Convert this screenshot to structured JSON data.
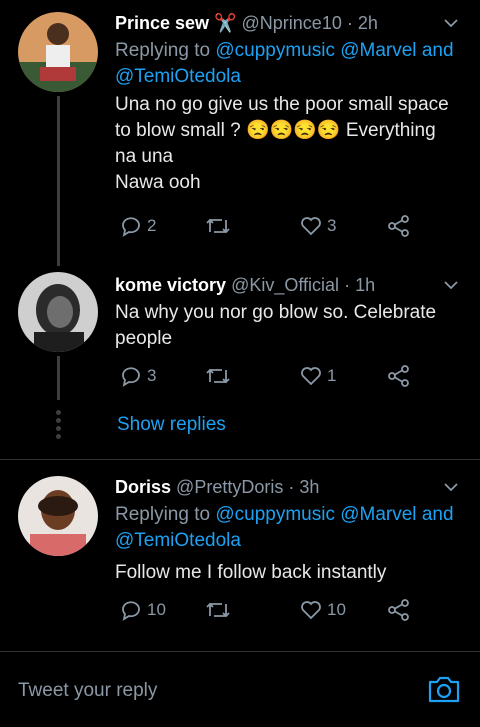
{
  "tweets": [
    {
      "name": "Prince sew",
      "emoji": "✂️",
      "handle": "@Nprince10",
      "time": "· 2h",
      "replying_prefix": "Replying to",
      "mention1": "@cuppymusic",
      "mention2": "@Marvel",
      "and_word": "and",
      "mention3": "@TemiOtedola",
      "text_line1": "Una no go give us the poor small space",
      "text_line2_start": "to blow small ?",
      "emoji_run": "😒😒😒😒",
      "text_line2_end": "Everything",
      "text_line3": "na una",
      "text_line4": "Nawa ooh",
      "replies": "2",
      "retweets": "",
      "likes": "3"
    },
    {
      "name": "kome victory",
      "handle": "@Kiv_Official",
      "time": "· 1h",
      "text_line1": "Na why you nor go blow so. Celebrate",
      "text_line2": "people",
      "replies": "3",
      "retweets": "",
      "likes": "1"
    },
    {
      "name": "Doriss",
      "handle": "@PrettyDoris",
      "time": "· 3h",
      "replying_prefix": "Replying to",
      "mention1": "@cuppymusic",
      "mention2": "@Marvel",
      "and_word": "and",
      "mention3": "@TemiOtedola",
      "text_line1": "Follow me I follow back instantly",
      "replies": "10",
      "retweets": "",
      "likes": "10"
    }
  ],
  "show_replies": "Show replies",
  "reply_bar": {
    "placeholder": "Tweet your reply"
  },
  "icons": [
    "chevron-down-icon",
    "reply-icon",
    "retweet-icon",
    "like-icon",
    "share-icon",
    "camera-icon"
  ],
  "colors": {
    "background": "#000000",
    "accent": "#1da1f2",
    "muted": "#8b98a5"
  }
}
